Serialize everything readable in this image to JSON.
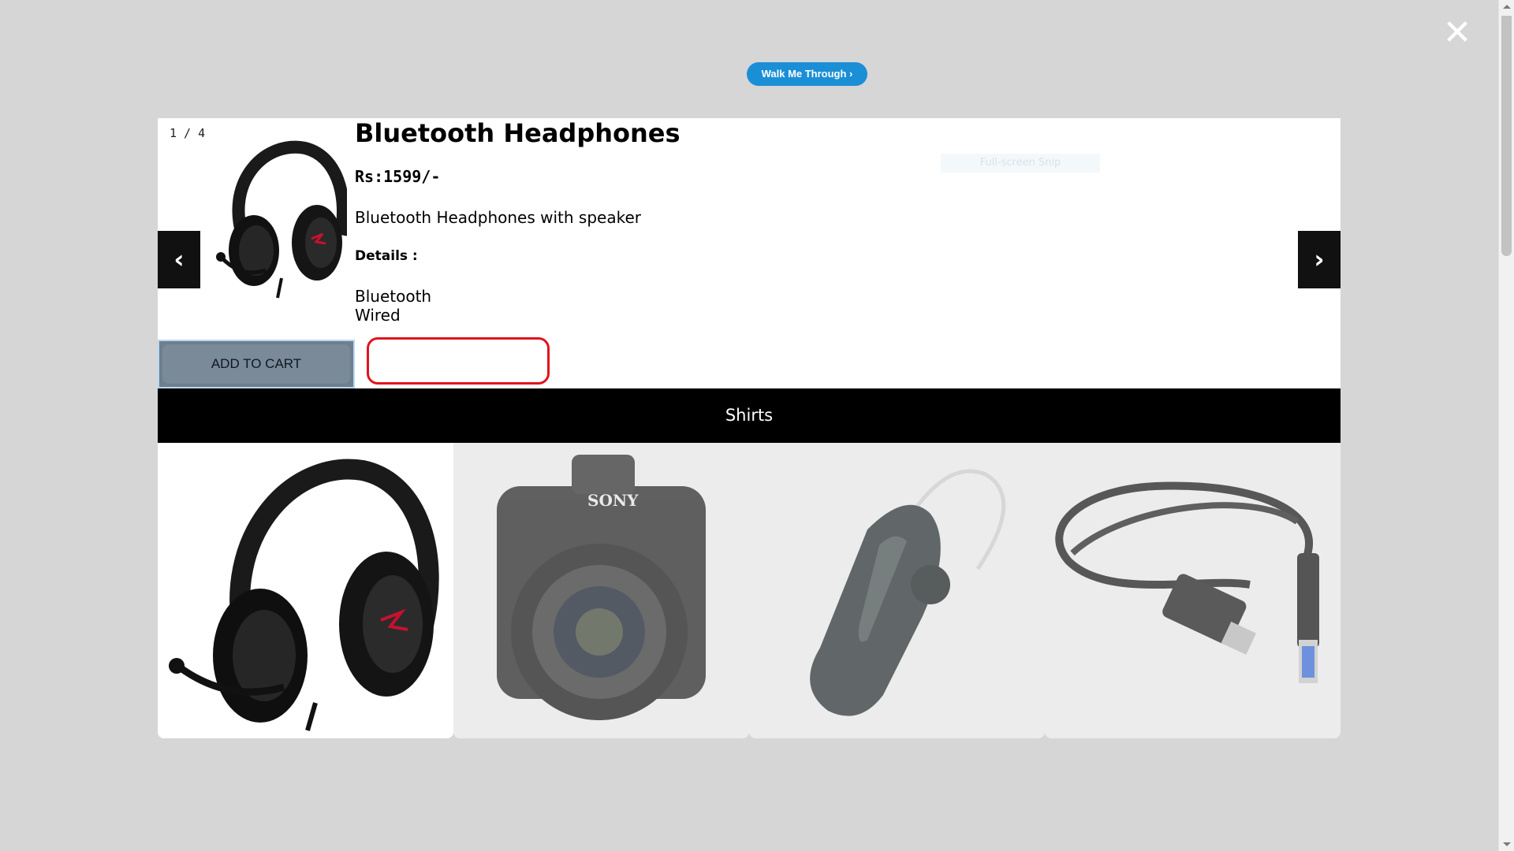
{
  "overlay": {
    "close_icon": "close-icon",
    "walkthrough_label": "Walk Me Through ›"
  },
  "product": {
    "counter": "1 / 4",
    "title": "Bluetooth Headphones",
    "price": "Rs:1599/-",
    "description": "Bluetooth Headphones with speaker",
    "details_label": "Details :",
    "details": [
      "Bluetooth",
      "Wired"
    ],
    "add_to_cart_label": "ADD TO CART",
    "faint_overlay_text": "Full-screen Snip"
  },
  "navigation": {
    "prev_icon": "‹",
    "next_icon": "›"
  },
  "category": {
    "title": "Shirts"
  },
  "thumbnails": [
    {
      "name": "headphones",
      "active": true
    },
    {
      "name": "camera",
      "active": false
    },
    {
      "name": "bluetooth-earpiece",
      "active": false
    },
    {
      "name": "usb-cable",
      "active": false
    }
  ],
  "colors": {
    "backdrop": "#d6d6d6",
    "walkthrough_button": "#1a8fd6",
    "highlight_outline": "#e0141e",
    "category_bar": "#000000"
  }
}
